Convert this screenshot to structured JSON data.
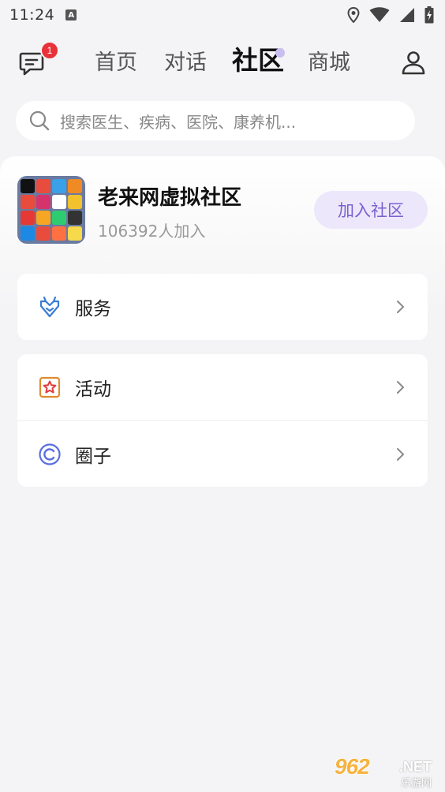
{
  "status_bar": {
    "time": "11:24",
    "notification_letter": "A",
    "icons": [
      "location-icon",
      "wifi-icon",
      "signal-icon",
      "battery-charging-icon"
    ]
  },
  "nav": {
    "message_badge_count": "1",
    "tabs": [
      {
        "label": "首页",
        "active": false
      },
      {
        "label": "对话",
        "active": false
      },
      {
        "label": "社区",
        "active": true
      },
      {
        "label": "商城",
        "active": false
      }
    ]
  },
  "search": {
    "placeholder": "搜索医生、疾病、医院、康养机..."
  },
  "community": {
    "name": "老来网虚拟社区",
    "member_count": "106392人加入",
    "join_label": "加入社区"
  },
  "menu": {
    "service_label": "服务",
    "activity_label": "活动",
    "circle_label": "圈子"
  },
  "watermark": {
    "big": "962",
    "net": ".NET",
    "sub": "乐游网"
  },
  "colors": {
    "accent": "#7a5fd0",
    "join_bg": "#ece7fb",
    "badge": "#e8323a",
    "service_icon": "#3a7bd5",
    "activity_icon": "#e08a2e",
    "activity_star": "#e03b3b",
    "circle_icon": "#5a6ee0"
  }
}
